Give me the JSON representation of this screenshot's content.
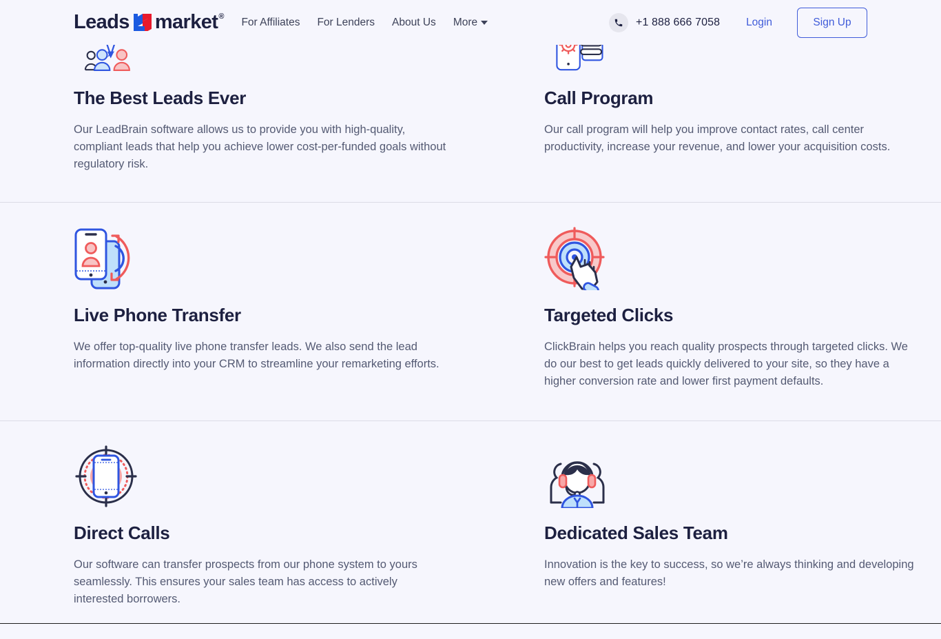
{
  "header": {
    "brand": {
      "word_left": "Leads",
      "word_right": "market",
      "registered": "®",
      "mark_icon": "leadsmarket-m-logo-icon"
    },
    "nav": [
      {
        "label": "For Affiliates",
        "name": "nav-for-affiliates"
      },
      {
        "label": "For Lenders",
        "name": "nav-for-lenders"
      },
      {
        "label": "About Us",
        "name": "nav-about-us"
      },
      {
        "label": "More",
        "name": "nav-more",
        "has_caret": true
      }
    ],
    "phone": {
      "icon": "phone-icon",
      "number": "+1 888 666 7058"
    },
    "login_label": "Login",
    "signup_label": "Sign Up",
    "accent_color": "#3f5bd9",
    "text_color": "#1d2040"
  },
  "features": [
    {
      "icon": "leads-people-arrows-icon",
      "title": "The Best Leads Ever",
      "description": "Our LeadBrain software allows us to provide you with high-quality, compliant leads that help you achieve lower cost-per-funded goals without regulatory risk."
    },
    {
      "icon": "phone-gear-list-icon",
      "title": "Call Program",
      "description": "Our call program will help you improve contact rates, call center productivity, increase your revenue, and lower your acquisition costs."
    },
    {
      "icon": "two-phones-transfer-icon",
      "title": "Live Phone Transfer",
      "description": "We offer top-quality live phone transfer leads. We also send the lead information directly into your CRM to streamline your remarketing efforts."
    },
    {
      "icon": "target-click-hand-icon",
      "title": "Targeted Clicks",
      "description": "ClickBrain helps you reach quality prospects through targeted clicks. We do our best to get leads quickly delivered to your site, so they have a higher conversion rate and lower first payment defaults."
    },
    {
      "icon": "phone-crosshair-icon",
      "title": "Direct Calls",
      "description": "Our software can transfer prospects from our phone system to yours seamlessly. This ensures your sales team has access to actively interested borrowers."
    },
    {
      "icon": "headset-agent-icon",
      "title": "Dedicated Sales Team",
      "description": "Innovation is the key to success, so we’re always thinking and developing new offers and features!"
    }
  ],
  "theme": {
    "background": "#f6f6fd",
    "divider": "#dcdce6",
    "body_text": "#545a73",
    "heading_text": "#1d2040",
    "blue": "#2f55e0",
    "red": "#f15b5b"
  }
}
